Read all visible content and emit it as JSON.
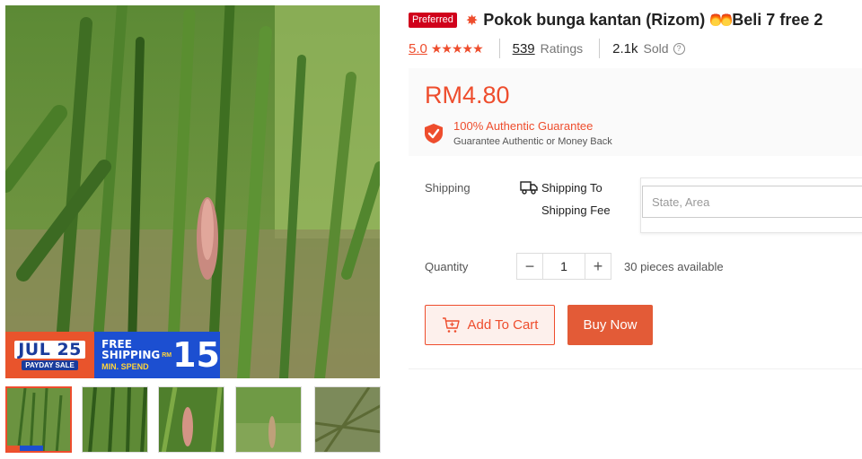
{
  "gallery": {
    "promo": {
      "event_label": "JUL 25",
      "event_sub": "PAYDAY SALE",
      "line1": "FREE",
      "line2": "SHIPPING",
      "line3": "MIN. SPEND",
      "currency": "RM",
      "amount": "15"
    },
    "thumbnail_count": 5,
    "active_thumbnail": 1
  },
  "product": {
    "badge": "Preferred",
    "spark_icon": "sparkle-icon",
    "title": "Pokok bunga kantan (Rizom)",
    "title_suffix": "Beli 7 free 2",
    "fire_icon": "fire-icon"
  },
  "rating": {
    "score": "5.0",
    "stars": "★★★★★",
    "ratings_count": "539",
    "ratings_label": "Ratings",
    "sold_count": "2.1k",
    "sold_label": "Sold",
    "help_icon": "?"
  },
  "price": {
    "value": "RM4.80",
    "guarantee_title": "100% Authentic Guarantee",
    "guarantee_sub": "Guarantee Authentic or Money Back"
  },
  "shipping": {
    "label": "Shipping",
    "to_label": "Shipping To",
    "fee_label": "Shipping Fee",
    "address_placeholder": "State, Area"
  },
  "quantity": {
    "label": "Quantity",
    "minus": "−",
    "value": "1",
    "plus": "+",
    "available": "30 pieces available"
  },
  "actions": {
    "add_to_cart": "Add To Cart",
    "buy_now": "Buy Now"
  },
  "colors": {
    "accent": "#ee4d2d",
    "preferred_badge": "#d0011b",
    "promo_blue": "#1c4fd1"
  }
}
